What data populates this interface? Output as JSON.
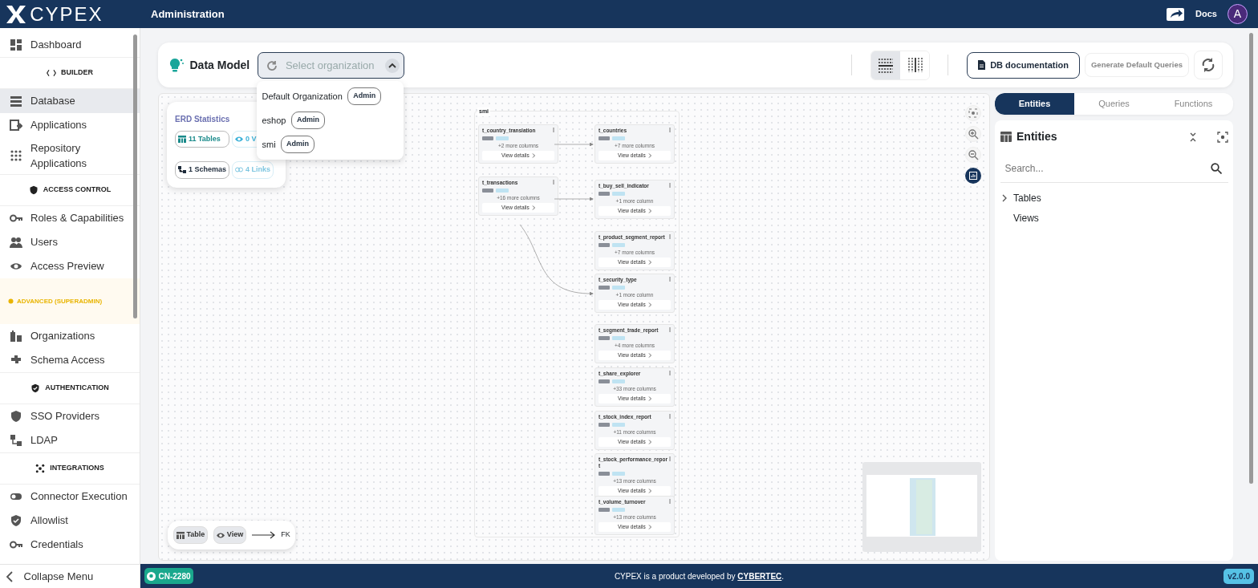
{
  "header": {
    "logo": "CYPEX",
    "title": "Administration",
    "docs": "Docs",
    "avatar": "A"
  },
  "sidebar": {
    "items": [
      {
        "kind": "item",
        "label": "Dashboard",
        "selected": false
      },
      {
        "kind": "section",
        "label": "BUILDER"
      },
      {
        "kind": "item",
        "label": "Database",
        "selected": true
      },
      {
        "kind": "item",
        "label": "Applications",
        "selected": false
      },
      {
        "kind": "item",
        "label": "Repository Applications",
        "selected": false
      },
      {
        "kind": "section",
        "label": "ACCESS CONTROL"
      },
      {
        "kind": "item",
        "label": "Roles & Capabilities",
        "selected": false
      },
      {
        "kind": "item",
        "label": "Users",
        "selected": false
      },
      {
        "kind": "item",
        "label": "Access Preview",
        "selected": false
      },
      {
        "kind": "warning",
        "label": "ADVANCED (SUPERADMIN)"
      },
      {
        "kind": "item",
        "label": "Organizations",
        "selected": false
      },
      {
        "kind": "item",
        "label": "Schema Access",
        "selected": false
      },
      {
        "kind": "section",
        "label": "AUTHENTICATION"
      },
      {
        "kind": "item",
        "label": "SSO Providers",
        "selected": false
      },
      {
        "kind": "item",
        "label": "LDAP",
        "selected": false
      },
      {
        "kind": "section",
        "label": "INTEGRATIONS"
      },
      {
        "kind": "item",
        "label": "Connector Execution",
        "selected": false
      },
      {
        "kind": "item",
        "label": "Allowlist",
        "selected": false
      },
      {
        "kind": "item",
        "label": "Credentials",
        "selected": false
      }
    ],
    "collapse": "Collapse Menu"
  },
  "toolbar": {
    "title": "Data Model",
    "select": {
      "placeholder": "Select organization"
    },
    "dropdown": [
      {
        "name": "Default Organization",
        "badge": "Admin"
      },
      {
        "name": "eshop",
        "badge": "Admin"
      },
      {
        "name": "smi",
        "badge": "Admin"
      }
    ],
    "view_toggle": [
      {
        "selected": true
      },
      {
        "selected": false
      }
    ],
    "doc_button": "DB documentation",
    "generate_button": "Generate Default Queries"
  },
  "stats": {
    "title": "ERD Statistics",
    "chips": [
      {
        "kind": "tables",
        "label": "11 Tables"
      },
      {
        "kind": "views",
        "label": "0 V"
      },
      {
        "kind": "schemas",
        "label": "1 Schemas"
      },
      {
        "kind": "links",
        "label": "4 Links"
      }
    ]
  },
  "erd": {
    "schema": "smi",
    "tables": [
      {
        "name": "t_country_translation",
        "more": "+2 more columns",
        "details": "View details"
      },
      {
        "name": "t_countries",
        "more": "+7 more columns",
        "details": "View details"
      },
      {
        "name": "t_transactions",
        "more": "+16 more columns",
        "details": "View details"
      },
      {
        "name": "t_buy_sell_indicator",
        "more": "+1 more column",
        "details": "View details"
      },
      {
        "name": "t_product_segment_report",
        "more": "+7 more columns",
        "details": "View details"
      },
      {
        "name": "t_security_type",
        "more": "+1 more column",
        "details": "View details"
      },
      {
        "name": "t_segment_trade_report",
        "more": "+4 more columns",
        "details": "View details"
      },
      {
        "name": "t_share_explorer",
        "more": "+33 more columns",
        "details": "View details"
      },
      {
        "name": "t_stock_index_report",
        "more": "+11 more columns",
        "details": "View details"
      },
      {
        "name": "t_stock_performance_report",
        "more": "+13 more columns",
        "details": "View details"
      },
      {
        "name": "t_volume_turnover",
        "more": "+13 more columns",
        "details": "View details"
      }
    ],
    "legend": {
      "table": "Table",
      "view": "View",
      "fk": "FK"
    }
  },
  "panel": {
    "tabs": [
      {
        "label": "Entities",
        "selected": true
      },
      {
        "label": "Queries",
        "selected": false
      },
      {
        "label": "Functions",
        "selected": false
      }
    ],
    "title": "Entities",
    "search": {
      "placeholder": "Search..."
    },
    "tree": [
      {
        "label": "Tables",
        "expandable": true
      },
      {
        "label": "Views",
        "expandable": false
      }
    ]
  },
  "footer": {
    "badge": "CN-2280",
    "text_before": "CYPEX is a product developed by ",
    "link": "CYBERTEC",
    "text_after": ".",
    "version": "v2.0.0"
  }
}
